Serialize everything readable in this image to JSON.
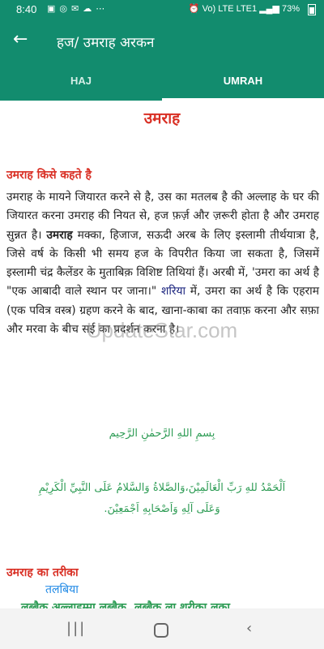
{
  "status_bar": {
    "time": "8:40",
    "left_icons": [
      "image-icon",
      "instagram-icon",
      "messenger-icon",
      "cloud-icon",
      "more-icon"
    ],
    "network": "Vo) LTE LTE1",
    "battery": "73%"
  },
  "app_bar": {
    "title": "हज/ उमराह अरकन",
    "back_icon": "arrow-left-icon"
  },
  "tabs": [
    {
      "label": "HAJ",
      "selected": false
    },
    {
      "label": "UMRAH",
      "selected": true
    }
  ],
  "content": {
    "page_title": "उमराह",
    "section1_heading": "उमराह किसे कहते है",
    "paragraph": {
      "part1": "उमराह के मायने जियारत करने से है, उस का मतलब है की अल्लाह के घर की जियारत करना उमराह की नियत से, हज फ़र्ज़ और ज़रूरी होता है और उमराह सुन्नत है। ",
      "bold": "उमराह",
      "part2": " मक्का, हिजाज, सऊदी अरब के लिए इस्लामी तीर्थयात्रा है, जिसे वर्ष के किसी भी समय हज के विपरीत किया जा सकता है, जिसमें इस्लामी चंद्र कैलेंडर के मुताबिक़ विशिष्ट तिथियां हैं। अरबी में, 'उमरा का अर्थ है \"एक आबादी वाले स्थान पर जाना।\" ",
      "blue": "शरिया",
      "part3": " में, उमरा का अर्थ है कि एहराम (एक पवित्र वस्त्र) ग्रहण करने के बाद, खाना-काबा का तवाफ़ करना और सफ़ा और मरवा के बीच सई का प्रदर्शन करना है।"
    },
    "arabic_basmala": "بِسمِ اللهِ الرَّحمٰنِ الرَّحِيم",
    "arabic_dua_line1": "اَلْحَمْدُ للهِ رَبِّ الْعَالَمِيْنَ،وَالصَّلاةُ وَالسَّلامُ عَلَى النَّبِيِّ الْكَرِيْمِ",
    "arabic_dua_line2": "وَعَلَى آلِهِ وَاَصْحَابِهِ اَجْمَعِيْنَ.",
    "section2_heading": "उमराह का तरीका",
    "subheading": "तलबिया",
    "talbiya_line": "लब्बैक अल्लाहुम्मा लब्बैक, लब्बैक ला शरीका लका"
  },
  "watermark": "UpdateStar.com",
  "nav_bar": {
    "recent_icon": "recent-apps-icon",
    "home_icon": "home-icon",
    "back_icon": "back-chevron-icon"
  },
  "colors": {
    "primary": "#128c6e",
    "heading_red": "#d93025",
    "arabic_green": "#2e9c55",
    "link_blue": "#1e88e5"
  }
}
